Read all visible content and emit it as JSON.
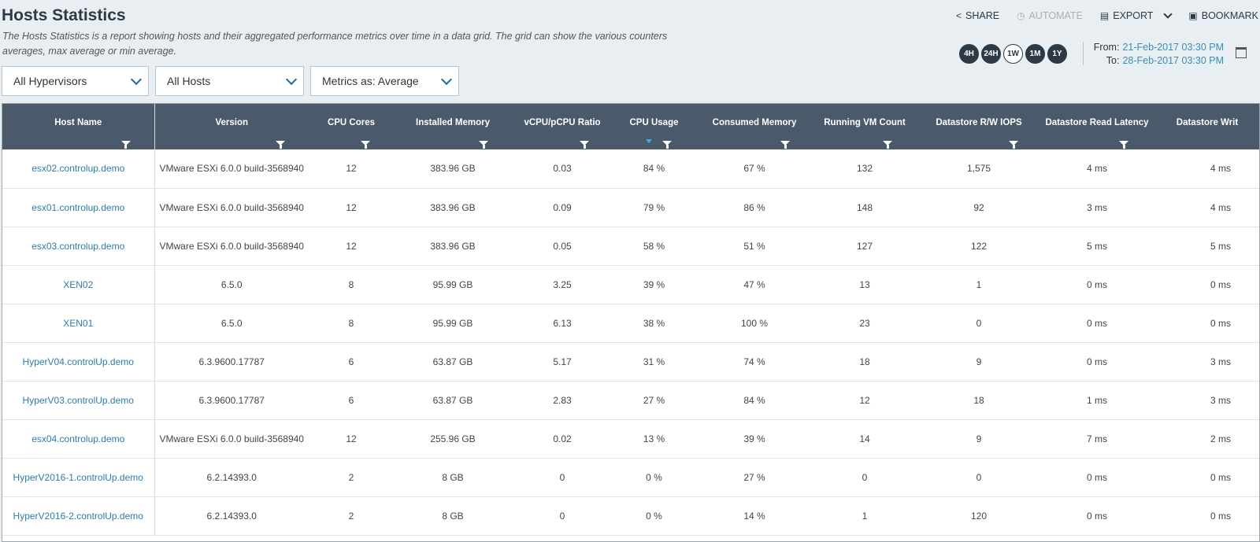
{
  "header": {
    "title": "Hosts Statistics",
    "description": "The Hosts Statistics is a report showing hosts and their aggregated performance metrics over time in a data grid. The grid can show the various counters averages, max average or min average."
  },
  "filters": {
    "hypervisors": "All Hypervisors",
    "hosts": "All Hosts",
    "metrics": "Metrics as: Average"
  },
  "actions": {
    "share": "SHARE",
    "automate": "AUTOMATE",
    "export": "EXPORT",
    "bookmark": "BOOKMARK"
  },
  "time_ranges": [
    "4H",
    "24H",
    "1W",
    "1M",
    "1Y"
  ],
  "selected_range": "1W",
  "dates": {
    "from_label": "From:",
    "from_value": "21-Feb-2017 03:30 PM",
    "to_label": "To:",
    "to_value": "28-Feb-2017 03:30 PM"
  },
  "table": {
    "columns": [
      "Host Name",
      "Version",
      "CPU Cores",
      "Installed Memory",
      "vCPU/pCPU Ratio",
      "CPU Usage",
      "Consumed Memory",
      "Running VM Count",
      "Datastore R/W IOPS",
      "Datastore Read Latency",
      "Datastore Writ"
    ],
    "rows": [
      [
        "esx02.controlup.demo",
        "VMware ESXi 6.0.0 build-3568940",
        "12",
        "383.96 GB",
        "0.03",
        "84 %",
        "67 %",
        "132",
        "1,575",
        "4 ms",
        "4 ms"
      ],
      [
        "esx01.controlup.demo",
        "VMware ESXi 6.0.0 build-3568940",
        "12",
        "383.96 GB",
        "0.09",
        "79 %",
        "86 %",
        "148",
        "92",
        "3 ms",
        "4 ms"
      ],
      [
        "esx03.controlup.demo",
        "VMware ESXi 6.0.0 build-3568940",
        "12",
        "383.96 GB",
        "0.05",
        "58 %",
        "51 %",
        "127",
        "122",
        "5 ms",
        "5 ms"
      ],
      [
        "XEN02",
        "6.5.0",
        "8",
        "95.99 GB",
        "3.25",
        "39 %",
        "47 %",
        "13",
        "1",
        "0 ms",
        "0 ms"
      ],
      [
        "XEN01",
        "6.5.0",
        "8",
        "95.99 GB",
        "6.13",
        "38 %",
        "100 %",
        "23",
        "0",
        "0 ms",
        "0 ms"
      ],
      [
        "HyperV04.controlUp.demo",
        "6.3.9600.17787",
        "6",
        "63.87 GB",
        "5.17",
        "31 %",
        "74 %",
        "18",
        "9",
        "0 ms",
        "3 ms"
      ],
      [
        "HyperV03.controlUp.demo",
        "6.3.9600.17787",
        "6",
        "63.87 GB",
        "2.83",
        "27 %",
        "84 %",
        "12",
        "18",
        "1 ms",
        "3 ms"
      ],
      [
        "esx04.controlup.demo",
        "VMware ESXi 6.0.0 build-3568940",
        "12",
        "255.96 GB",
        "0.02",
        "13 %",
        "39 %",
        "14",
        "9",
        "7 ms",
        "2 ms"
      ],
      [
        "HyperV2016-1.controlUp.demo",
        "6.2.14393.0",
        "2",
        "8 GB",
        "0",
        "0 %",
        "27 %",
        "0",
        "0",
        "0 ms",
        "0 ms"
      ],
      [
        "HyperV2016-2.controlUp.demo",
        "6.2.14393.0",
        "2",
        "8 GB",
        "0",
        "0 %",
        "14 %",
        "1",
        "120",
        "0 ms",
        "0 ms"
      ]
    ]
  }
}
